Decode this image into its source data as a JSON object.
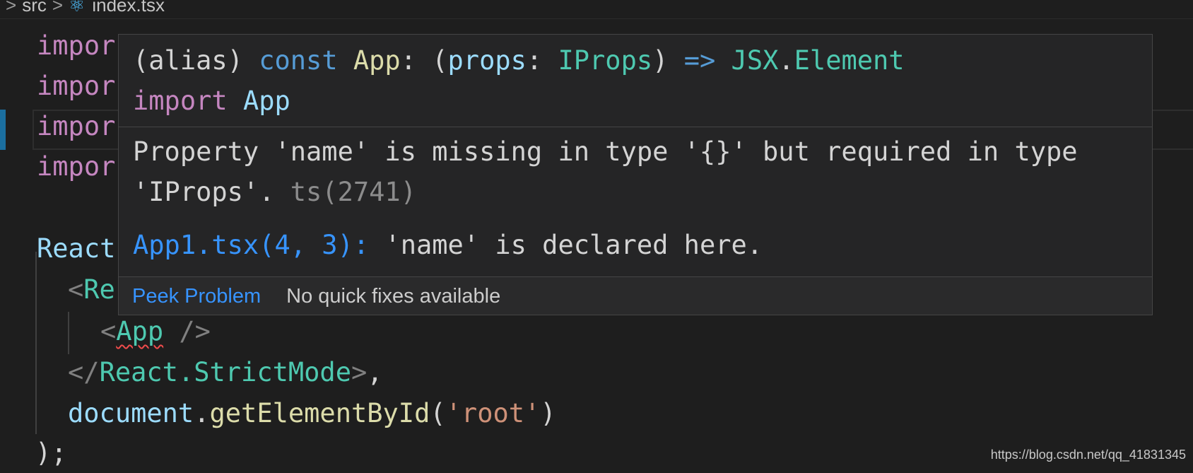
{
  "breadcrumb": {
    "folder": "src",
    "file": "index.tsx",
    "react_icon": "react-icon"
  },
  "code": {
    "line1": {
      "kw": "impor"
    },
    "line2": {
      "kw": "impor"
    },
    "line3": {
      "kw": "impor"
    },
    "line4": {
      "kw": "impor"
    },
    "line6": {
      "var": "React"
    },
    "line7": {
      "open": "<",
      "comp": "Re"
    },
    "line8": {
      "open": "<",
      "comp": "App",
      "close": " />"
    },
    "line9": {
      "open": "</",
      "comp": "React.StrictMode",
      "close": ">",
      "comma": ","
    },
    "line10": {
      "obj": "document",
      "dot": ".",
      "method": "getElementById",
      "lp": "(",
      "arg": "'root'",
      "rp": ")"
    },
    "line11": {
      "text": ");"
    }
  },
  "hover": {
    "sig_alias": "(alias) ",
    "sig_const": "const ",
    "sig_name": "App",
    "sig_colon": ": (",
    "sig_param": "props",
    "sig_colon2": ": ",
    "sig_type": "IProps",
    "sig_paren": ") ",
    "sig_arrow": "=>",
    "sig_space": " ",
    "sig_ns": "JSX",
    "sig_dot": ".",
    "sig_elem": "Element",
    "import_kw": "import ",
    "import_name": "App",
    "message": "Property 'name' is missing in type '{}' but required in type 'IProps'. ",
    "message_code": "ts(2741)",
    "related_loc": "App1.tsx(4, 3): ",
    "related_text": "'name' is declared here.",
    "peek_label": "Peek Problem",
    "no_fix_label": "No quick fixes available"
  },
  "watermark": "https://blog.csdn.net/qq_41831345",
  "colors": {
    "background": "#1e1e1e",
    "keyword": "#c586c0",
    "variable": "#9cdcfe",
    "type": "#4ec9b0",
    "function": "#dcdcaa",
    "string": "#ce9178",
    "link": "#3794ff",
    "error_squiggle": "#f14c4c"
  }
}
